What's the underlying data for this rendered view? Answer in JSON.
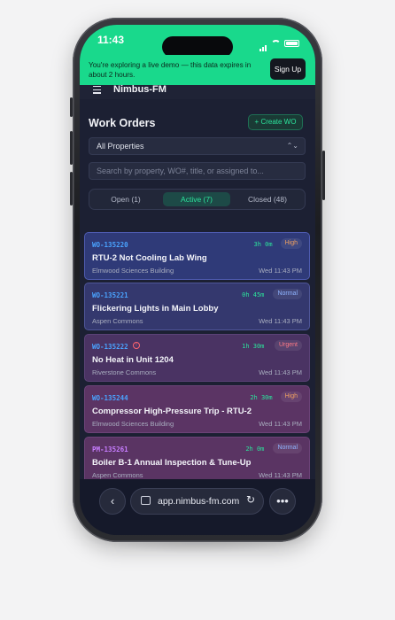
{
  "status": {
    "time": "11:43"
  },
  "banner": {
    "text": "You're exploring a live demo — this data expires in about 2 hours.",
    "signup_label": "Sign Up"
  },
  "nav": {
    "brand": "Nimbus-FM"
  },
  "page": {
    "title": "Work Orders",
    "create_label": "+ Create WO",
    "property_select": "All Properties",
    "search_placeholder": "Search by property, WO#, title, or assigned to...",
    "tabs": [
      {
        "label": "Open (1)",
        "active": false
      },
      {
        "label": "Active (7)",
        "active": true
      },
      {
        "label": "Closed (48)",
        "active": false
      }
    ]
  },
  "work_orders": [
    {
      "id": "WO-135220",
      "id_color": "#4aa3ff",
      "alert": false,
      "elapsed": "3h 0m",
      "priority": "High",
      "priority_color": "#f0a060",
      "title": "RTU-2 Not Cooling Lab Wing",
      "location": "Elmwood Sciences Building",
      "date": "Wed 11:43 PM",
      "bg": "#2f3a78",
      "border": "#4e5bb0"
    },
    {
      "id": "WO-135221",
      "id_color": "#4aa3ff",
      "alert": false,
      "elapsed": "0h 45m",
      "priority": "Normal",
      "priority_color": "#8fb4ff",
      "title": "Flickering Lights in Main Lobby",
      "location": "Aspen Commons",
      "date": "Wed 11:43 PM",
      "bg": "#34386e",
      "border": "#4f5699"
    },
    {
      "id": "WO-135222",
      "id_color": "#4aa3ff",
      "alert": true,
      "elapsed": "1h 30m",
      "priority": "Urgent",
      "priority_color": "#ff7a85",
      "title": "No Heat in Unit 1204",
      "location": "Riverstone Commons",
      "date": "Wed 11:43 PM",
      "bg": "#4a3363",
      "border": "#5b4277"
    },
    {
      "id": "WO-135244",
      "id_color": "#4aa3ff",
      "alert": false,
      "elapsed": "2h 30m",
      "priority": "High",
      "priority_color": "#f0a060",
      "title": "Compressor High-Pressure Trip - RTU-2",
      "location": "Elmwood Sciences Building",
      "date": "Wed 11:43 PM",
      "bg": "#5b3464",
      "border": "#6c4378"
    },
    {
      "id": "PM-135261",
      "id_color": "#c77dff",
      "alert": false,
      "elapsed": "2h 0m",
      "priority": "Normal",
      "priority_color": "#8fb4ff",
      "title": "Boiler B-1 Annual Inspection & Tune-Up",
      "location": "Aspen Commons",
      "date": "Wed 11:43 PM",
      "bg": "#5a3463",
      "border": "#6c4378"
    }
  ],
  "browser": {
    "url": "app.nimbus-fm.com",
    "back_icon": "chevron-left-icon",
    "more_icon": "ellipsis-icon"
  }
}
